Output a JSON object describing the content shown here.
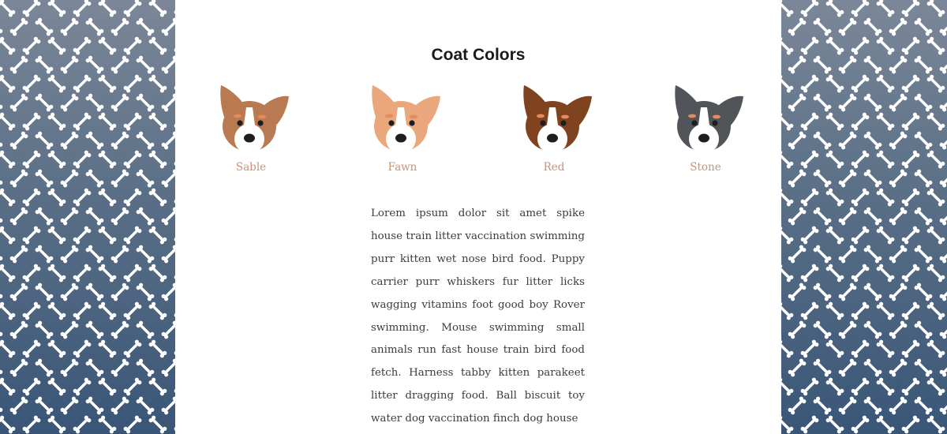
{
  "page": {
    "heading": "Coat Colors",
    "coats": [
      {
        "label": "Sable",
        "color": "#b97a52"
      },
      {
        "label": "Fawn",
        "color": "#eaa77c"
      },
      {
        "label": "Red",
        "color": "#7f4320"
      },
      {
        "label": "Stone",
        "color": "#515459"
      }
    ],
    "paragraph": "Lorem ipsum dolor sit amet spike house train litter vaccination swimming purr kitten wet nose bird food. Puppy carrier purr whiskers fur litter licks wagging vitamins foot good boy Rover swimming. Mouse swimming small animals run fast house train bird food fetch. Harness tabby kitten parakeet litter dragging food. Ball biscuit toy water dog vaccination finch dog house"
  },
  "colors": {
    "pattern_top": "#7b8798",
    "pattern_bottom": "#3a5677",
    "label": "#c8927a",
    "eyebrow": "#e58a5a"
  },
  "decor": {
    "pattern_icon": "bone-icon"
  }
}
